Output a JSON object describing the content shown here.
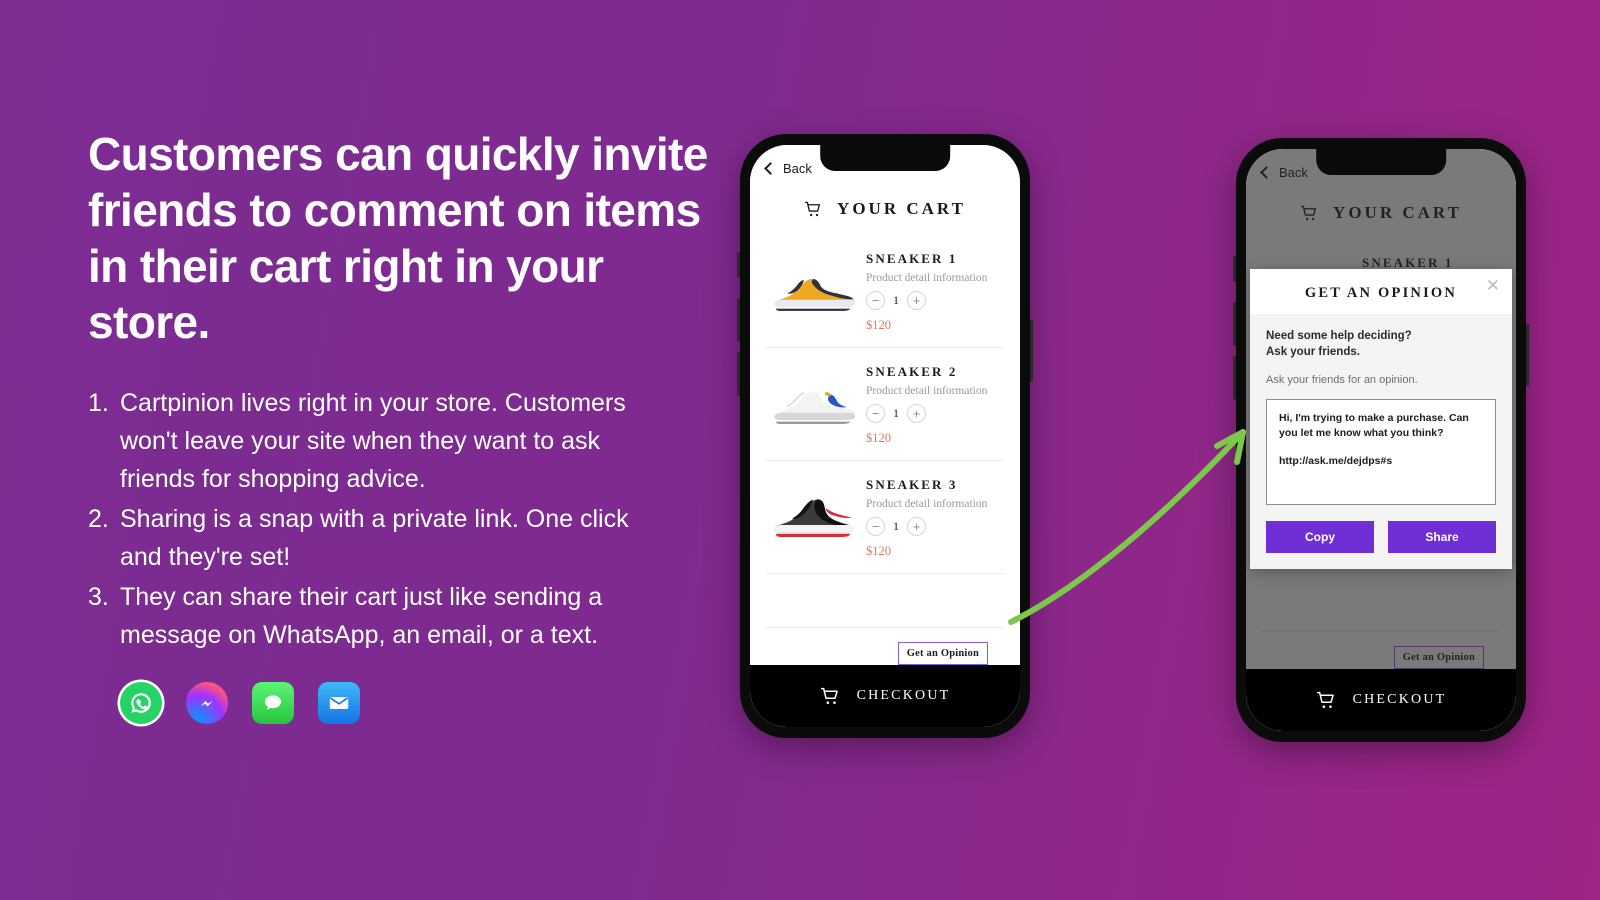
{
  "background": {
    "gradient_from": "#7B2D92",
    "gradient_to": "#9E2485"
  },
  "headline": "Customers can quickly invite friends to comment on items in their cart right in your store.",
  "bullets": [
    {
      "num": "1.",
      "text": "Cartpinion lives right in your store. Customers won't leave your site when they want to ask friends for shopping advice."
    },
    {
      "num": "2.",
      "text": "Sharing is a snap with a private link. One click and they're set!"
    },
    {
      "num": "3.",
      "text": "They can share their cart just like sending a message on WhatsApp, an email, or a text."
    }
  ],
  "app_icons": [
    {
      "name": "whatsapp-icon",
      "label": "WhatsApp",
      "color": "#25D366"
    },
    {
      "name": "messenger-icon",
      "label": "Messenger",
      "color": "#A033FF"
    },
    {
      "name": "messages-icon",
      "label": "Messages",
      "color": "#28C53C"
    },
    {
      "name": "mail-icon",
      "label": "Mail",
      "color": "#1473E6"
    }
  ],
  "phone_cart": {
    "back_label": "Back",
    "title": "YOUR CART",
    "items": [
      {
        "name": "SNEAKER 1",
        "desc": "Product detail information",
        "qty": "1",
        "price": "$120",
        "minus": "−",
        "plus": "+"
      },
      {
        "name": "SNEAKER 2",
        "desc": "Product detail information",
        "qty": "1",
        "price": "$120",
        "minus": "−",
        "plus": "+"
      },
      {
        "name": "SNEAKER 3",
        "desc": "Product detail information",
        "qty": "1",
        "price": "$120",
        "minus": "−",
        "plus": "+"
      }
    ],
    "opinion_button": "Get an Opinion",
    "checkout_label": "CHECKOUT",
    "price_color": "#E8735A",
    "opinion_border_color": "#8B59D6"
  },
  "modal": {
    "title": "GET AN OPINION",
    "close": "✕",
    "bold_line_1": "Need some help deciding?",
    "bold_line_2": "Ask your friends.",
    "subtitle": "Ask your friends for an opinion.",
    "message": "Hi, I'm trying to make a purchase. Can you let me know what you think?",
    "link": "http://ask.me/dejdps#s",
    "copy_label": "Copy",
    "share_label": "Share",
    "button_color": "#6E30D6"
  },
  "annotation": {
    "arrow_color": "#7DC84B"
  }
}
